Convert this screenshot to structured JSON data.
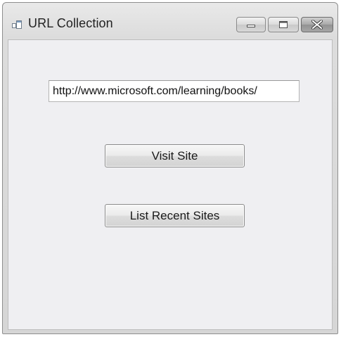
{
  "window": {
    "title": "URL Collection",
    "icon": "form-icon",
    "controls": {
      "minimize_icon": "minimize-icon",
      "maximize_icon": "maximize-icon",
      "close_icon": "close-icon"
    }
  },
  "form": {
    "url_input": {
      "value": "http://www.microsoft.com/learning/books/",
      "placeholder": ""
    },
    "visit_button_label": "Visit Site",
    "list_button_label": "List Recent Sites"
  },
  "colors": {
    "client_background": "#efeff2",
    "titlebar_background": "#dcdcdc",
    "button_border": "#8b8b8b"
  }
}
